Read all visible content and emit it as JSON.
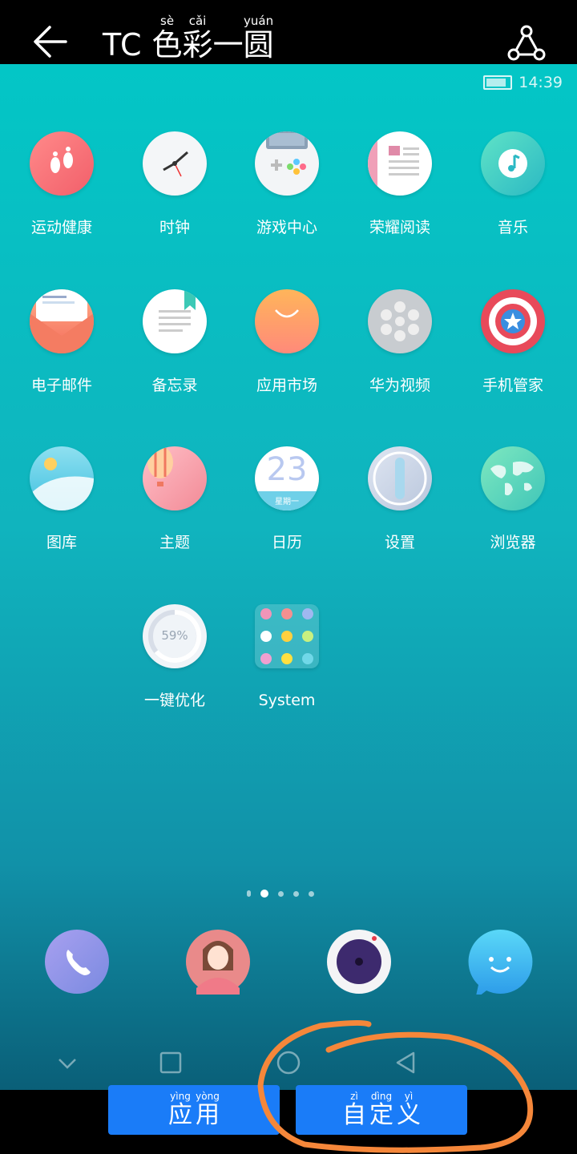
{
  "header": {
    "back_icon": "arrow-left-icon",
    "title_latin": "TC",
    "title_chars": [
      {
        "char": "色",
        "pinyin": "sè"
      },
      {
        "char": "彩",
        "pinyin": "cǎi"
      },
      {
        "char": "一",
        "pinyin": ""
      },
      {
        "char": "圆",
        "pinyin": "yuán"
      }
    ],
    "share_icon": "share-icon"
  },
  "status_bar": {
    "time": "14:39",
    "battery_icon": "battery-charging-icon"
  },
  "apps": [
    {
      "label": "运动健康",
      "icon": "health-footprints-icon"
    },
    {
      "label": "时钟",
      "icon": "clock-icon"
    },
    {
      "label": "游戏中心",
      "icon": "gamepad-icon"
    },
    {
      "label": "荣耀阅读",
      "icon": "reader-icon"
    },
    {
      "label": "音乐",
      "icon": "music-icon"
    },
    {
      "label": "电子邮件",
      "icon": "email-icon"
    },
    {
      "label": "备忘录",
      "icon": "notepad-icon"
    },
    {
      "label": "应用市场",
      "icon": "app-market-icon"
    },
    {
      "label": "华为视频",
      "icon": "video-reel-icon"
    },
    {
      "label": "手机管家",
      "icon": "phone-manager-shield-icon"
    },
    {
      "label": "图库",
      "icon": "gallery-icon"
    },
    {
      "label": "主题",
      "icon": "themes-balloon-icon"
    },
    {
      "label": "日历",
      "icon": "calendar-icon"
    },
    {
      "label": "设置",
      "icon": "settings-icon"
    },
    {
      "label": "浏览器",
      "icon": "browser-globe-icon"
    },
    {
      "label": "一键优化",
      "icon": "optimizer-icon"
    },
    {
      "label": "System",
      "icon": "folder-icon"
    }
  ],
  "calendar_icon": {
    "day": "23",
    "weekday": "星期一"
  },
  "optimizer_icon": {
    "percent": "59%"
  },
  "page_indicator": {
    "pages": 4,
    "current": 1
  },
  "dock": [
    {
      "name": "phone",
      "icon": "phone-icon"
    },
    {
      "name": "contacts",
      "icon": "contacts-icon"
    },
    {
      "name": "camera",
      "icon": "camera-icon"
    },
    {
      "name": "messages",
      "icon": "messages-icon"
    }
  ],
  "nav_buttons": [
    "chevron-down-icon",
    "recents-square-icon",
    "home-circle-icon",
    "back-triangle-icon"
  ],
  "tabs": [
    {
      "chars": [
        {
          "char": "应",
          "pinyin": "yìng"
        },
        {
          "char": "用",
          "pinyin": "yòng"
        }
      ]
    },
    {
      "chars": [
        {
          "char": "自",
          "pinyin": "zì"
        },
        {
          "char": "定",
          "pinyin": "dìng"
        },
        {
          "char": "义",
          "pinyin": "yì"
        }
      ]
    }
  ],
  "colors": {
    "accent": "#1a7cf8",
    "annotation": "#f5873a",
    "background_top": "#03c6c6"
  }
}
